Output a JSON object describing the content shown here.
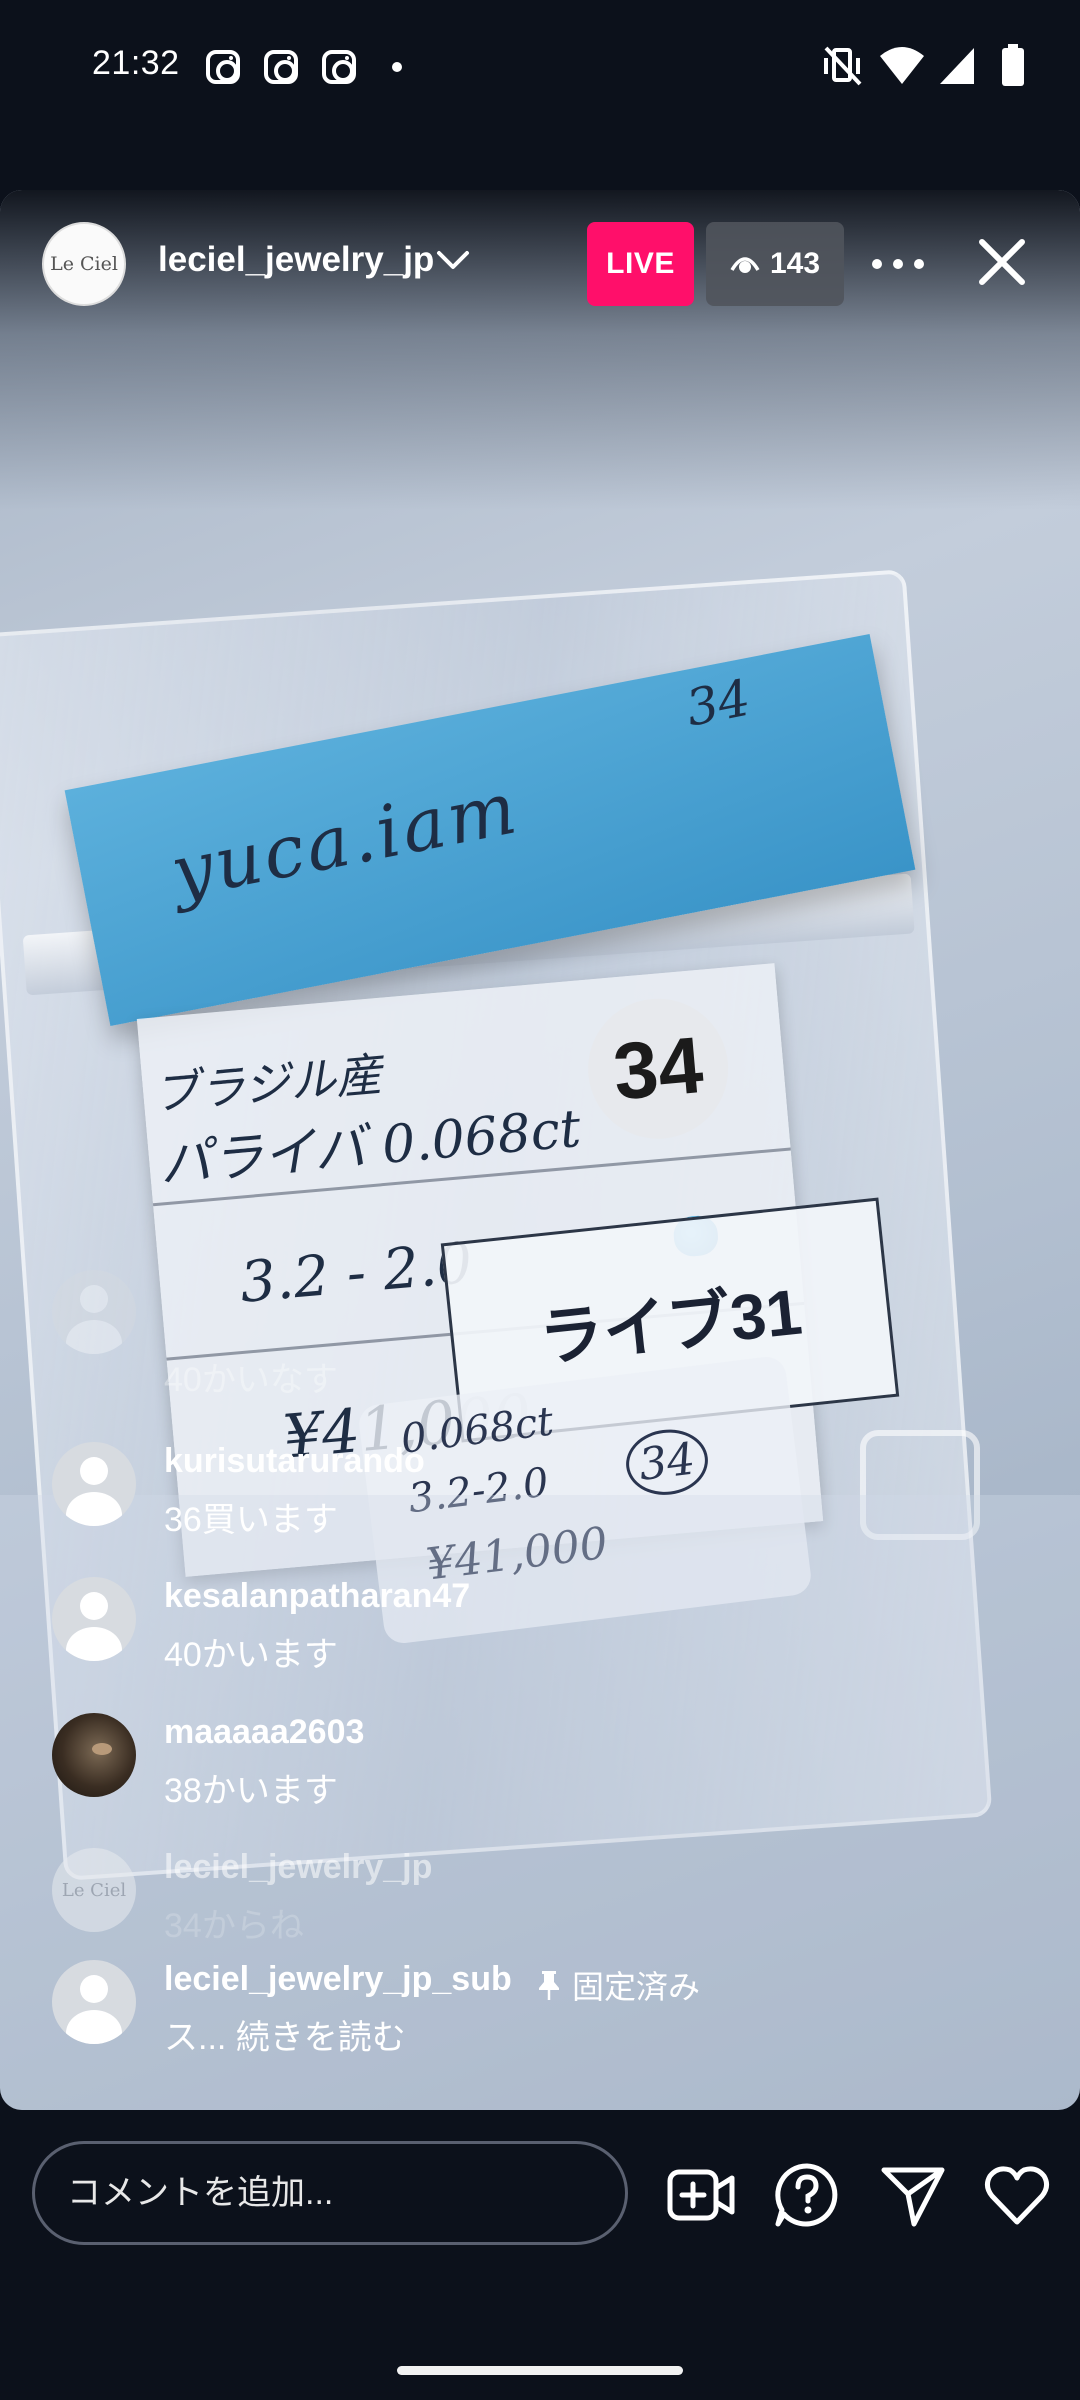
{
  "status_bar": {
    "time": "21:32",
    "notification_icons": [
      "instagram-icon",
      "instagram-icon",
      "instagram-icon",
      "dot-icon"
    ],
    "system_icons": [
      "vibrate-off-icon",
      "wifi-icon",
      "cell-signal-icon",
      "battery-icon"
    ]
  },
  "live": {
    "host": {
      "username": "leciel_jewelry_jp",
      "avatar_text": "Le Ciel"
    },
    "live_label": "LIVE",
    "viewer_count": "143",
    "accent_color": "#ff0f6a"
  },
  "video": {
    "note_name": "yuca.iam",
    "note_number": "34",
    "badge_number": "34",
    "card_line1": "ブラジル産",
    "card_line2": "パライバ 0.068ct",
    "card_line3": "3.2 - 2.0",
    "card_line4": "¥41,000",
    "label": "ライブ31",
    "small_card_line1": "0.068ct",
    "small_card_line2": "3.2-2.0",
    "small_card_line3": "¥41,000",
    "small_card_num": "34"
  },
  "comments": [
    {
      "username": "",
      "text": "40かいなす"
    },
    {
      "username": "kurisutarurando",
      "text": "36買います"
    },
    {
      "username": "kesalanpatharan47",
      "text": "40かいます"
    },
    {
      "username": "maaaaa2603",
      "text": "38かいます"
    },
    {
      "username": "leciel_jewelry_jp",
      "text": "34からね"
    },
    {
      "username": "leciel_jewelry_jp_sub",
      "text": "ス... 続きを読む",
      "pinned_label": "固定済み"
    }
  ],
  "bottom_bar": {
    "comment_placeholder": "コメントを追加...",
    "icons": [
      "add-video-icon",
      "question-icon",
      "send-icon",
      "heart-icon"
    ]
  }
}
